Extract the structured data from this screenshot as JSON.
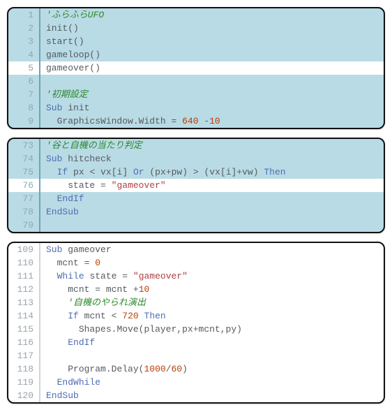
{
  "panels": [
    {
      "highlighted": true,
      "lines": [
        {
          "num": 1,
          "nohl": false,
          "tokens": [
            [
              "comment",
              "'ふらふらUFO"
            ]
          ]
        },
        {
          "num": 2,
          "nohl": false,
          "tokens": [
            [
              "id",
              "init"
            ],
            [
              "op",
              "()"
            ]
          ]
        },
        {
          "num": 3,
          "nohl": false,
          "tokens": [
            [
              "id",
              "start"
            ],
            [
              "op",
              "()"
            ]
          ]
        },
        {
          "num": 4,
          "nohl": false,
          "tokens": [
            [
              "id",
              "gameloop"
            ],
            [
              "op",
              "()"
            ]
          ]
        },
        {
          "num": 5,
          "nohl": true,
          "tokens": [
            [
              "id",
              "gameover"
            ],
            [
              "op",
              "()"
            ]
          ]
        },
        {
          "num": 6,
          "nohl": false,
          "tokens": []
        },
        {
          "num": 7,
          "nohl": false,
          "tokens": [
            [
              "comment",
              "'初期設定"
            ]
          ]
        },
        {
          "num": 8,
          "nohl": false,
          "tokens": [
            [
              "kw",
              "Sub"
            ],
            [
              "sp",
              " "
            ],
            [
              "id",
              "init"
            ]
          ]
        },
        {
          "num": 9,
          "nohl": false,
          "tokens": [
            [
              "sp",
              "  "
            ],
            [
              "obj",
              "GraphicsWindow"
            ],
            [
              "op",
              "."
            ],
            [
              "id",
              "Width"
            ],
            [
              "sp",
              " "
            ],
            [
              "op",
              "="
            ],
            [
              "sp",
              " "
            ],
            [
              "num",
              "640"
            ],
            [
              "sp",
              " "
            ],
            [
              "op",
              "-"
            ],
            [
              "num",
              "10"
            ]
          ]
        }
      ]
    },
    {
      "highlighted": true,
      "lines": [
        {
          "num": 73,
          "nohl": false,
          "tokens": [
            [
              "comment",
              "'谷と自機の当たり判定"
            ]
          ]
        },
        {
          "num": 74,
          "nohl": false,
          "tokens": [
            [
              "kw",
              "Sub"
            ],
            [
              "sp",
              " "
            ],
            [
              "id",
              "hitcheck"
            ]
          ]
        },
        {
          "num": 75,
          "nohl": false,
          "tokens": [
            [
              "sp",
              "  "
            ],
            [
              "kw",
              "If"
            ],
            [
              "sp",
              " "
            ],
            [
              "id",
              "px"
            ],
            [
              "sp",
              " "
            ],
            [
              "op",
              "<"
            ],
            [
              "sp",
              " "
            ],
            [
              "id",
              "vx"
            ],
            [
              "op",
              "["
            ],
            [
              "id",
              "i"
            ],
            [
              "op",
              "]"
            ],
            [
              "sp",
              " "
            ],
            [
              "kw",
              "Or"
            ],
            [
              "sp",
              " "
            ],
            [
              "op",
              "("
            ],
            [
              "id",
              "px"
            ],
            [
              "op",
              "+"
            ],
            [
              "id",
              "pw"
            ],
            [
              "op",
              ")"
            ],
            [
              "sp",
              " "
            ],
            [
              "op",
              ">"
            ],
            [
              "sp",
              " "
            ],
            [
              "op",
              "("
            ],
            [
              "id",
              "vx"
            ],
            [
              "op",
              "["
            ],
            [
              "id",
              "i"
            ],
            [
              "op",
              "]+"
            ],
            [
              "id",
              "vw"
            ],
            [
              "op",
              ")"
            ],
            [
              "sp",
              " "
            ],
            [
              "kw",
              "Then"
            ]
          ]
        },
        {
          "num": 76,
          "nohl": true,
          "tokens": [
            [
              "sp",
              "    "
            ],
            [
              "id",
              "state"
            ],
            [
              "sp",
              " "
            ],
            [
              "op",
              "="
            ],
            [
              "sp",
              " "
            ],
            [
              "str",
              "\"gameover\""
            ]
          ]
        },
        {
          "num": 77,
          "nohl": false,
          "tokens": [
            [
              "sp",
              "  "
            ],
            [
              "kw",
              "EndIf"
            ]
          ]
        },
        {
          "num": 78,
          "nohl": false,
          "tokens": [
            [
              "kw",
              "EndSub"
            ]
          ]
        },
        {
          "num": 79,
          "nohl": false,
          "tokens": []
        }
      ]
    },
    {
      "highlighted": false,
      "lines": [
        {
          "num": 109,
          "nohl": false,
          "tokens": [
            [
              "kw",
              "Sub"
            ],
            [
              "sp",
              " "
            ],
            [
              "id",
              "gameover"
            ]
          ]
        },
        {
          "num": 110,
          "nohl": false,
          "tokens": [
            [
              "sp",
              "  "
            ],
            [
              "id",
              "mcnt"
            ],
            [
              "sp",
              " "
            ],
            [
              "op",
              "="
            ],
            [
              "sp",
              " "
            ],
            [
              "num",
              "0"
            ]
          ]
        },
        {
          "num": 111,
          "nohl": false,
          "tokens": [
            [
              "sp",
              "  "
            ],
            [
              "kw",
              "While"
            ],
            [
              "sp",
              " "
            ],
            [
              "id",
              "state"
            ],
            [
              "sp",
              " "
            ],
            [
              "op",
              "="
            ],
            [
              "sp",
              " "
            ],
            [
              "str",
              "\"gameover\""
            ]
          ]
        },
        {
          "num": 112,
          "nohl": false,
          "tokens": [
            [
              "sp",
              "    "
            ],
            [
              "id",
              "mcnt"
            ],
            [
              "sp",
              " "
            ],
            [
              "op",
              "="
            ],
            [
              "sp",
              " "
            ],
            [
              "id",
              "mcnt"
            ],
            [
              "sp",
              " "
            ],
            [
              "op",
              "+"
            ],
            [
              "num",
              "10"
            ]
          ]
        },
        {
          "num": 113,
          "nohl": false,
          "tokens": [
            [
              "sp",
              "    "
            ],
            [
              "comment",
              "'自機のやられ演出"
            ]
          ]
        },
        {
          "num": 114,
          "nohl": false,
          "tokens": [
            [
              "sp",
              "    "
            ],
            [
              "kw",
              "If"
            ],
            [
              "sp",
              " "
            ],
            [
              "id",
              "mcnt"
            ],
            [
              "sp",
              " "
            ],
            [
              "op",
              "<"
            ],
            [
              "sp",
              " "
            ],
            [
              "num",
              "720"
            ],
            [
              "sp",
              " "
            ],
            [
              "kw",
              "Then"
            ]
          ]
        },
        {
          "num": 115,
          "nohl": false,
          "tokens": [
            [
              "sp",
              "      "
            ],
            [
              "obj",
              "Shapes"
            ],
            [
              "op",
              "."
            ],
            [
              "id",
              "Move"
            ],
            [
              "op",
              "("
            ],
            [
              "id",
              "player"
            ],
            [
              "op",
              ","
            ],
            [
              "id",
              "px"
            ],
            [
              "op",
              "+"
            ],
            [
              "id",
              "mcnt"
            ],
            [
              "op",
              ","
            ],
            [
              "id",
              "py"
            ],
            [
              "op",
              ")"
            ]
          ]
        },
        {
          "num": 116,
          "nohl": false,
          "tokens": [
            [
              "sp",
              "    "
            ],
            [
              "kw",
              "EndIf"
            ]
          ]
        },
        {
          "num": 117,
          "nohl": false,
          "tokens": []
        },
        {
          "num": 118,
          "nohl": false,
          "tokens": [
            [
              "sp",
              "    "
            ],
            [
              "obj",
              "Program"
            ],
            [
              "op",
              "."
            ],
            [
              "id",
              "Delay"
            ],
            [
              "op",
              "("
            ],
            [
              "num",
              "1000"
            ],
            [
              "op",
              "/"
            ],
            [
              "num",
              "60"
            ],
            [
              "op",
              ")"
            ]
          ]
        },
        {
          "num": 119,
          "nohl": false,
          "tokens": [
            [
              "sp",
              "  "
            ],
            [
              "kw",
              "EndWhile"
            ]
          ]
        },
        {
          "num": 120,
          "nohl": false,
          "tokens": [
            [
              "kw",
              "EndSub"
            ]
          ]
        }
      ]
    }
  ]
}
